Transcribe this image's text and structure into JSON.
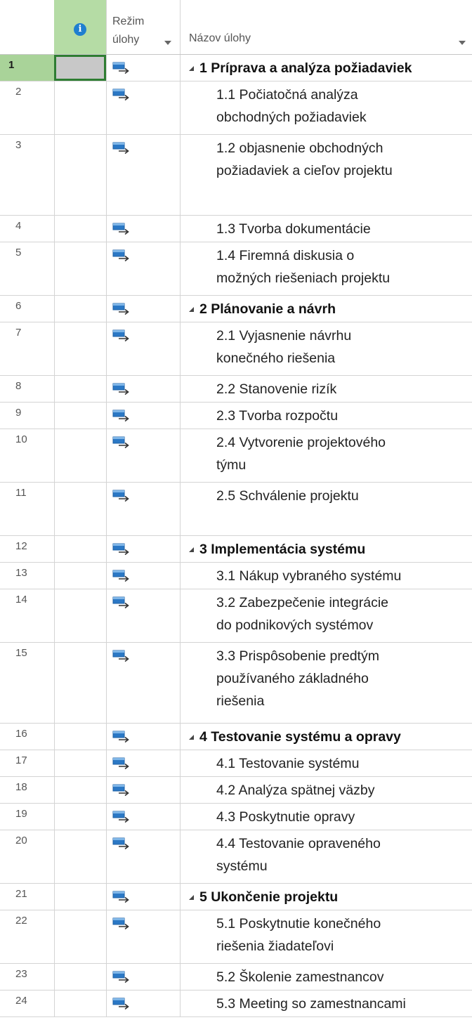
{
  "header": {
    "info_icon": "info-icon",
    "mode_label": "Režim\núlohy",
    "name_label": "Názov úlohy"
  },
  "rows": [
    {
      "id": "1",
      "name": "1 Príprava a analýza požiadaviek",
      "summary": true,
      "lines": 1,
      "selected": true
    },
    {
      "id": "2",
      "name": "1.1 Počiatočná analýza\nobchodných požiadaviek",
      "summary": false,
      "lines": 2
    },
    {
      "id": "3",
      "name": "1.2 objasnenie obchodných\npožiadaviek a cieľov projektu",
      "summary": false,
      "lines": 3
    },
    {
      "id": "4",
      "name": "1.3 Tvorba dokumentácie",
      "summary": false,
      "lines": 1
    },
    {
      "id": "5",
      "name": "1.4 Firemná diskusia o\nmožných riešeniach projektu",
      "summary": false,
      "lines": 2
    },
    {
      "id": "6",
      "name": "2 Plánovanie a návrh",
      "summary": true,
      "lines": 1
    },
    {
      "id": "7",
      "name": "2.1 Vyjasnenie návrhu\nkonečného riešenia",
      "summary": false,
      "lines": 2
    },
    {
      "id": "8",
      "name": "2.2 Stanovenie rizík",
      "summary": false,
      "lines": 1
    },
    {
      "id": "9",
      "name": "2.3 Tvorba rozpočtu",
      "summary": false,
      "lines": 1
    },
    {
      "id": "10",
      "name": "2.4 Vytvorenie projektového\ntýmu",
      "summary": false,
      "lines": 2
    },
    {
      "id": "11",
      "name": "2.5 Schválenie projektu",
      "summary": false,
      "lines": 2
    },
    {
      "id": "12",
      "name": "3 Implementácia systému",
      "summary": true,
      "lines": 1
    },
    {
      "id": "13",
      "name": "3.1 Nákup vybraného systému",
      "summary": false,
      "lines": 1
    },
    {
      "id": "14",
      "name": "3.2 Zabezpečenie integrácie\ndo podnikových systémov",
      "summary": false,
      "lines": 2
    },
    {
      "id": "15",
      "name": "3.3 Prispôsobenie predtým\npoužívaného základného\nriešenia",
      "summary": false,
      "lines": 3
    },
    {
      "id": "16",
      "name": "4 Testovanie systému a opravy",
      "summary": true,
      "lines": 1
    },
    {
      "id": "17",
      "name": "4.1 Testovanie systému",
      "summary": false,
      "lines": 1
    },
    {
      "id": "18",
      "name": "4.2 Analýza spätnej väzby",
      "summary": false,
      "lines": 1
    },
    {
      "id": "19",
      "name": "4.3 Poskytnutie opravy",
      "summary": false,
      "lines": 1
    },
    {
      "id": "20",
      "name": "4.4 Testovanie opraveného\nsystému",
      "summary": false,
      "lines": 2
    },
    {
      "id": "21",
      "name": "5 Ukončenie projektu",
      "summary": true,
      "lines": 1
    },
    {
      "id": "22",
      "name": "5.1 Poskytnutie konečného\nriešenia žiadateľovi",
      "summary": false,
      "lines": 2
    },
    {
      "id": "23",
      "name": "5.2 Školenie zamestnancov",
      "summary": false,
      "lines": 1
    },
    {
      "id": "24",
      "name": "5.3 Meeting so zamestnancami",
      "summary": false,
      "lines": 1
    }
  ],
  "colors": {
    "selected_row": "#a9d399",
    "info_header": "#b5dca5",
    "mode_icon": "#2b78c5"
  },
  "icons": {
    "task_mode": "auto-scheduled-task-icon",
    "summary_toggle": "collapse-triangle-icon",
    "column_menu": "chevron-down-icon"
  }
}
